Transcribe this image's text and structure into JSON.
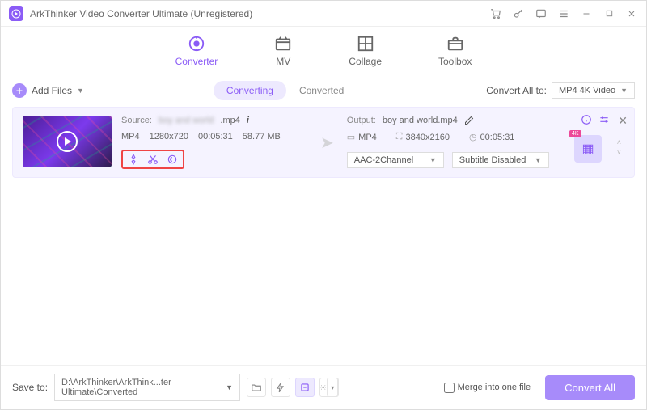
{
  "window": {
    "title": "ArkThinker Video Converter Ultimate (Unregistered)"
  },
  "tabs": {
    "converter": "Converter",
    "mv": "MV",
    "collage": "Collage",
    "toolbox": "Toolbox"
  },
  "toolbar": {
    "add_files": "Add Files",
    "converting": "Converting",
    "converted": "Converted",
    "convert_all_to": "Convert All to:",
    "format_selected": "MP4 4K Video"
  },
  "file": {
    "source_label": "Source:",
    "source_name_blur": "boy and world",
    "source_ext": ".mp4",
    "output_label": "Output:",
    "output_name": "boy and world.mp4",
    "container": "MP4",
    "src_res": "1280x720",
    "duration": "00:05:31",
    "size": "58.77 MB",
    "out_container": "MP4",
    "out_res": "3840x2160",
    "out_duration": "00:05:31",
    "audio_sel": "AAC-2Channel",
    "subtitle_sel": "Subtitle Disabled"
  },
  "footer": {
    "save_to": "Save to:",
    "path": "D:\\ArkThinker\\ArkThink...ter Ultimate\\Converted",
    "merge": "Merge into one file",
    "convert_all": "Convert All"
  }
}
